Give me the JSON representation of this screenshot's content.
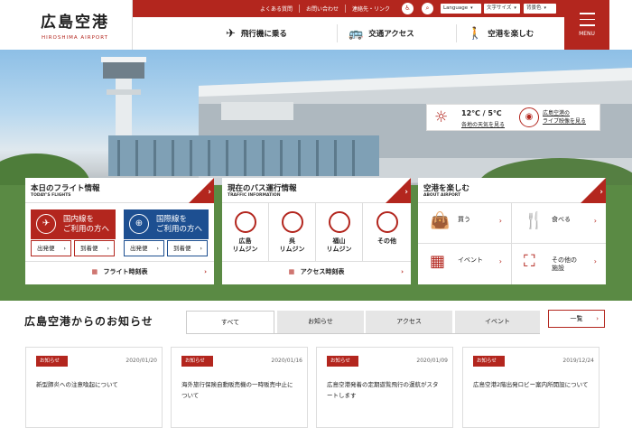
{
  "header": {
    "logo_ja": "広島空港",
    "logo_en": "HIROSHIMA AIRPORT",
    "top_links": [
      "よくある質問",
      "お問い合わせ",
      "連絡先・リンク"
    ],
    "language_label": "Language",
    "font_size_label": "文字サイズ",
    "bg_color_label": "背景色",
    "menu_label": "MENU",
    "nav": [
      {
        "label": "飛行機に乗る",
        "icon": "airplane-icon"
      },
      {
        "label": "交通アクセス",
        "icon": "bus-icon"
      },
      {
        "label": "空港を楽しむ",
        "icon": "walker-icon"
      }
    ]
  },
  "weather": {
    "temp": "12℃ / 5℃",
    "forecast_link": "各地の天気を見る",
    "live_line1": "広島空港の",
    "live_line2": "ライブ映像を見る"
  },
  "flights": {
    "title": "本日のフライト情報",
    "subtitle": "TODAY'S FLIGHTS",
    "domestic_line1": "国内線を",
    "domestic_line2": "ご利用の方へ",
    "international_line1": "国際線を",
    "international_line2": "ご利用の方へ",
    "depart": "出発便",
    "arrive": "到着便",
    "timetable": "フライト時刻表",
    "domestic_color": "#b3261e",
    "international_color": "#1d4f91"
  },
  "bus": {
    "title": "現在のバス運行情報",
    "subtitle": "TRAFFIC INFORMATION",
    "routes": [
      {
        "line1": "広島",
        "line2": "リムジン"
      },
      {
        "line1": "呉",
        "line2": "リムジン"
      },
      {
        "line1": "福山",
        "line2": "リムジン"
      },
      {
        "line1": "その他",
        "line2": ""
      }
    ],
    "timetable": "アクセス時刻表"
  },
  "enjoy": {
    "title": "空港を楽しむ",
    "subtitle": "ABOUT AIRPORT",
    "items": [
      {
        "line1": "買う",
        "line2": "",
        "icon": "shopping-bag-icon"
      },
      {
        "line1": "食べる",
        "line2": "",
        "icon": "cutlery-icon"
      },
      {
        "line1": "イベント",
        "line2": "",
        "icon": "calendar-icon"
      },
      {
        "line1": "その他の",
        "line2": "施設",
        "icon": "facility-icon"
      }
    ]
  },
  "news": {
    "title": "広島空港からのお知らせ",
    "tabs": [
      "すべて",
      "お知らせ",
      "アクセス",
      "イベント"
    ],
    "more": "一覧",
    "items": [
      {
        "badge": "お知らせ",
        "date": "2020/01/20",
        "text": "新型肺炎への注意喚起について"
      },
      {
        "badge": "お知らせ",
        "date": "2020/01/16",
        "text": "海外旅行保険自動販売機の一時販売中止について"
      },
      {
        "badge": "お知らせ",
        "date": "2020/01/09",
        "text": "広島空港発着の定期遊覧飛行の運航がスタートします"
      },
      {
        "badge": "お知らせ",
        "date": "2019/12/24",
        "text": "広島空港2階出発ロビー案内所開設について"
      }
    ]
  },
  "colors": {
    "accent": "#b3261e"
  }
}
